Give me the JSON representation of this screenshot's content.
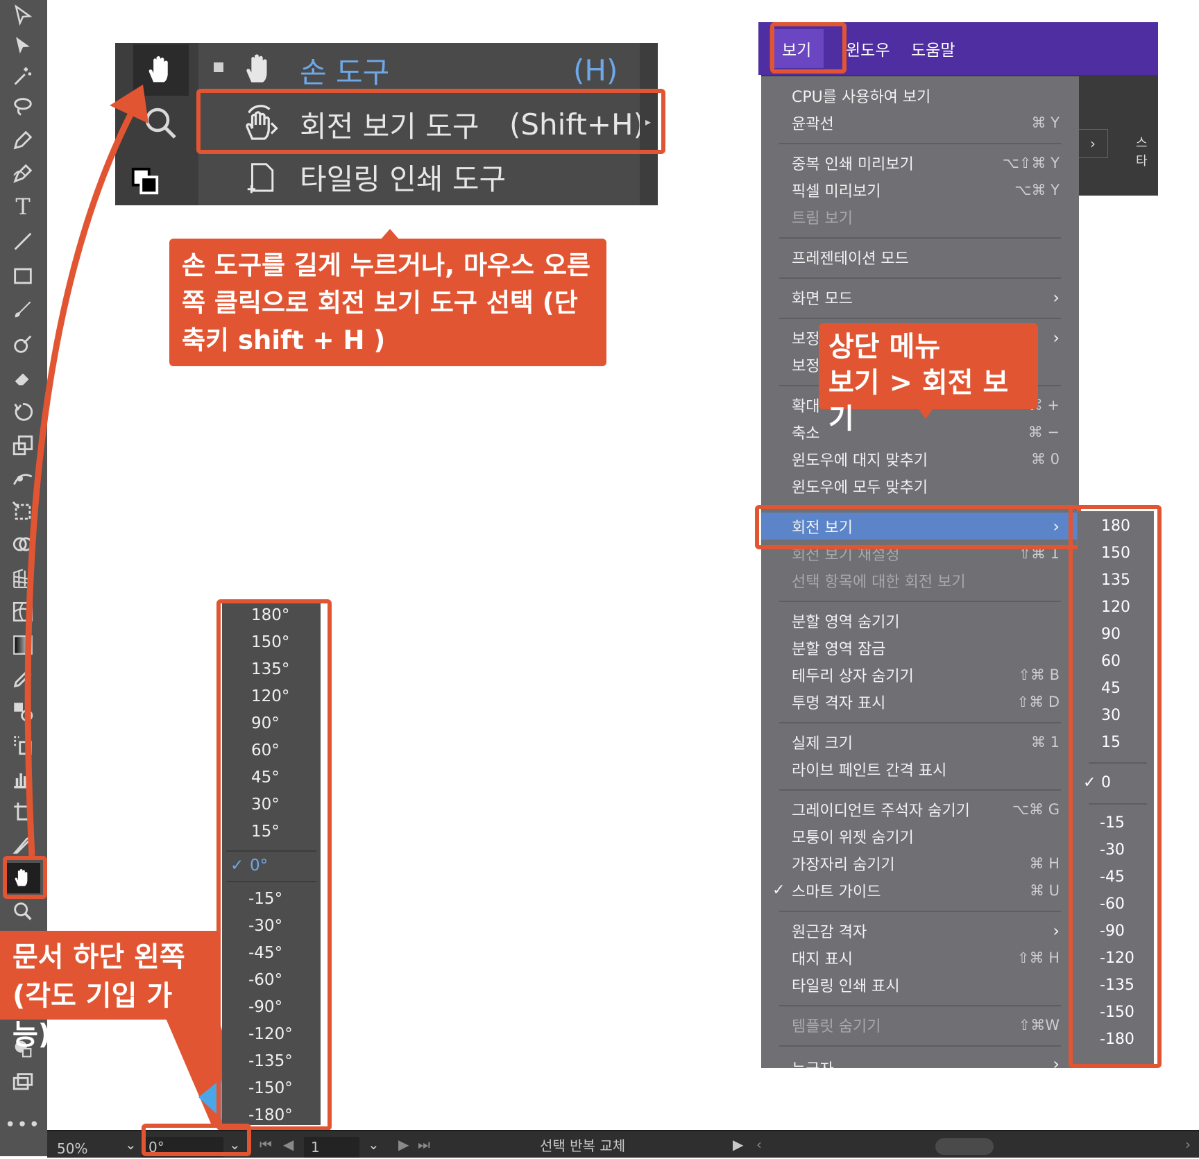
{
  "flyout": {
    "tools": [
      {
        "label": "손 도구",
        "shortcut": "(H)"
      },
      {
        "label": "회전 보기 도구",
        "shortcut": "(Shift+H)"
      },
      {
        "label": "타일링 인쇄 도구",
        "shortcut": ""
      }
    ]
  },
  "callouts": {
    "flyout_note": "손 도구를 길게 누르거나, 마우스 오른쪽 클릭으로 회전 보기 도구 선택 (단축키 shift + H )",
    "menu_note_line1": "상단 메뉴",
    "menu_note_line2": "보기 > 회전 보기",
    "bottom_note_line1": "문서 하단 왼쪽",
    "bottom_note_line2": "(각도 기입 가능)"
  },
  "angle_dropdown": {
    "options": [
      "180°",
      "150°",
      "135°",
      "120°",
      "90°",
      "60°",
      "45°",
      "30°",
      "15°",
      "0°",
      "-15°",
      "-30°",
      "-45°",
      "-60°",
      "-90°",
      "-120°",
      "-135°",
      "-150°",
      "-180°"
    ],
    "selected": "0°"
  },
  "statusbar": {
    "zoom": "50%",
    "rotation": "0°",
    "artboard": "1",
    "status_text": "선택 반복 교체"
  },
  "menubar": {
    "items": [
      "보기",
      "윈도우",
      "도움말"
    ],
    "active": "보기"
  },
  "behind_panel": {
    "text": "스타"
  },
  "view_menu": {
    "items": [
      {
        "label": "CPU를 사용하여 보기",
        "shortcut": ""
      },
      {
        "label": "윤곽선",
        "shortcut": "⌘ Y"
      },
      {
        "label": "중복 인쇄 미리보기",
        "shortcut": "⌥⇧⌘ Y"
      },
      {
        "label": "픽셀 미리보기",
        "shortcut": "⌥⌘ Y"
      },
      {
        "label": "트림 보기",
        "shortcut": ""
      },
      {
        "label": "프레젠테이션 모드",
        "shortcut": ""
      },
      {
        "label": "화면 모드",
        "shortcut": ""
      },
      {
        "label": "보정",
        "shortcut": ""
      },
      {
        "label": "보정",
        "shortcut": ""
      },
      {
        "label": "확대",
        "shortcut": "⌘ +"
      },
      {
        "label": "축소",
        "shortcut": "⌘ −"
      },
      {
        "label": "윈도우에 대지 맞추기",
        "shortcut": "⌘ 0"
      },
      {
        "label": "윈도우에 모두 맞추기",
        "shortcut": ""
      },
      {
        "label": "회전 보기",
        "shortcut": ""
      },
      {
        "label": "회전 보기 재설정",
        "shortcut": "⇧⌘ 1"
      },
      {
        "label": "선택 항목에 대한 회전 보기",
        "shortcut": ""
      },
      {
        "label": "분할 영역 숨기기",
        "shortcut": ""
      },
      {
        "label": "분할 영역 잠금",
        "shortcut": ""
      },
      {
        "label": "테두리 상자 숨기기",
        "shortcut": "⇧⌘ B"
      },
      {
        "label": "투명 격자 표시",
        "shortcut": "⇧⌘ D"
      },
      {
        "label": "실제 크기",
        "shortcut": "⌘ 1"
      },
      {
        "label": "라이브 페인트 간격 표시",
        "shortcut": ""
      },
      {
        "label": "그레이디언트 주석자 숨기기",
        "shortcut": "⌥⌘ G"
      },
      {
        "label": "모퉁이 위젯 숨기기",
        "shortcut": ""
      },
      {
        "label": "가장자리 숨기기",
        "shortcut": "⌘ H"
      },
      {
        "label": "스마트 가이드",
        "shortcut": "⌘ U"
      },
      {
        "label": "원근감 격자",
        "shortcut": ""
      },
      {
        "label": "대지 표시",
        "shortcut": "⇧⌘ H"
      },
      {
        "label": "타일링 인쇄 표시",
        "shortcut": ""
      },
      {
        "label": "템플릿 숨기기",
        "shortcut": "⇧⌘W"
      },
      {
        "label": "눈금자",
        "shortcut": ""
      }
    ]
  },
  "rotate_submenu": {
    "options": [
      "180",
      "150",
      "135",
      "120",
      "90",
      "60",
      "45",
      "30",
      "15",
      "0",
      "-15",
      "-30",
      "-45",
      "-60",
      "-90",
      "-120",
      "-135",
      "-150",
      "-180"
    ],
    "checked": "0"
  },
  "colors": {
    "accent": "#e15533",
    "menu_highlight": "#5b84c9",
    "menubar": "#4e2ea0",
    "pointer": "#4aa6e6"
  }
}
